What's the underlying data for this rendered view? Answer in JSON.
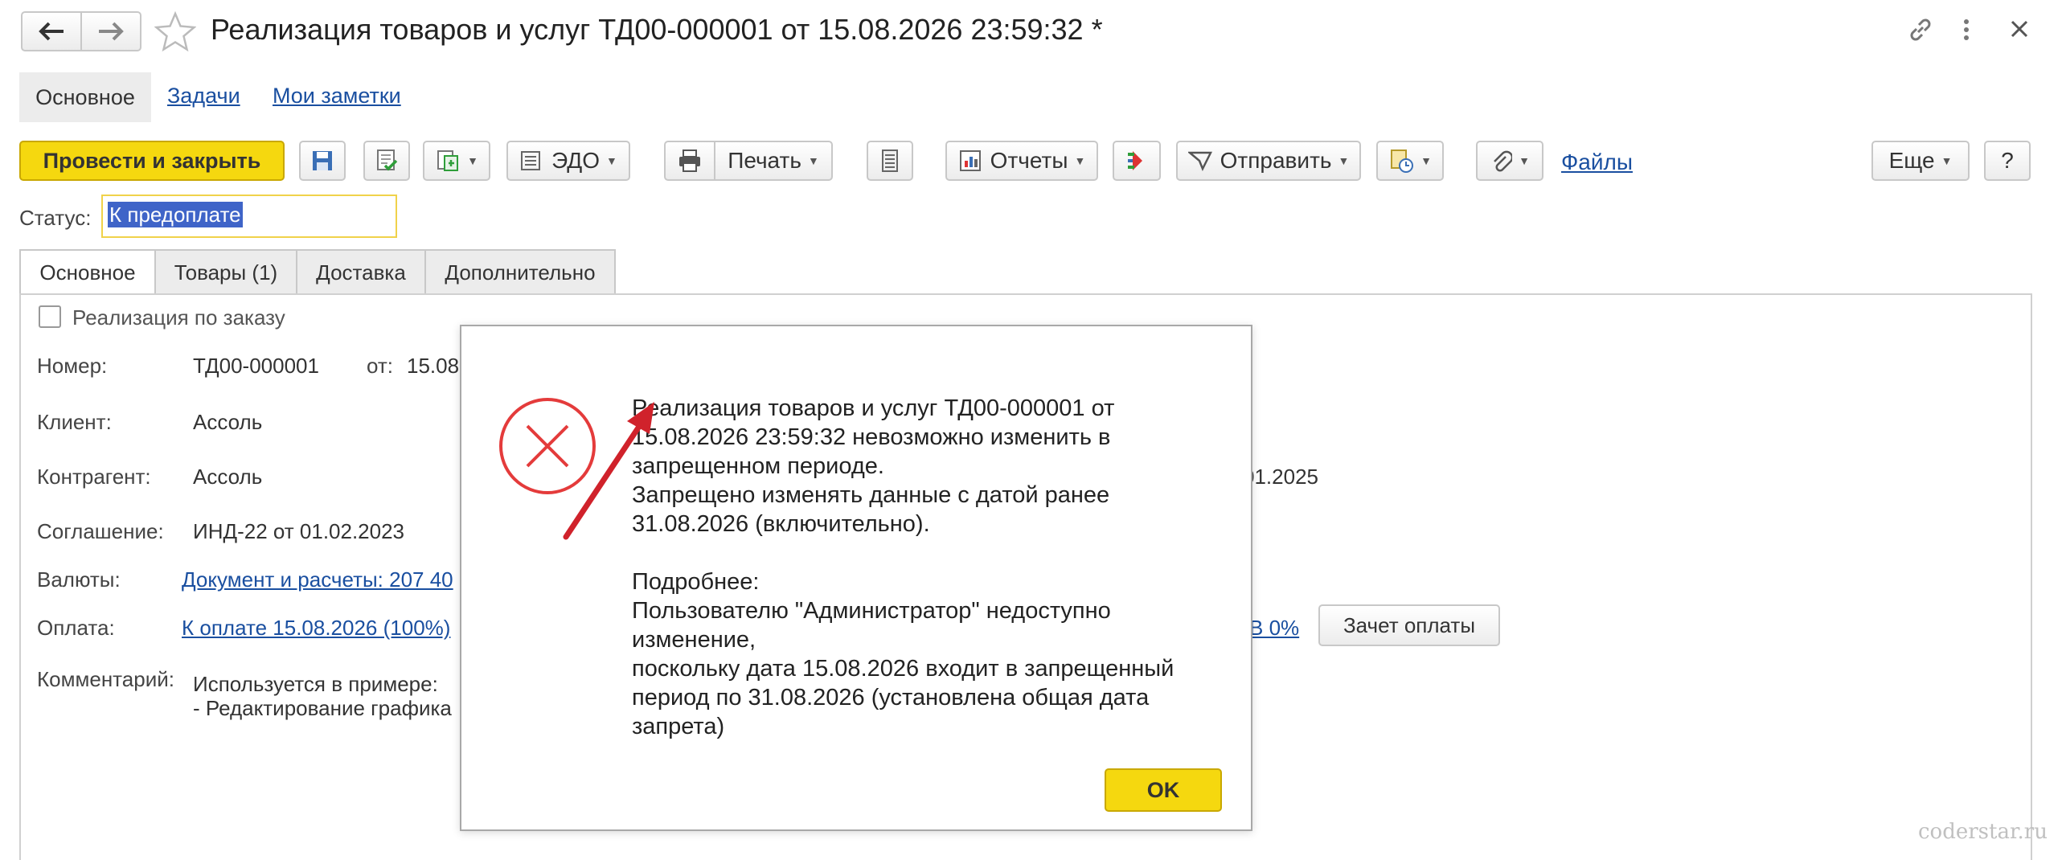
{
  "window": {
    "title": "Реализация товаров и услуг ТД00-000001 от 15.08.2026 23:59:32 *"
  },
  "nav_tabs": [
    {
      "label": "Основное"
    },
    {
      "label": "Задачи"
    },
    {
      "label": "Мои заметки"
    }
  ],
  "toolbar": {
    "post_close": "Провести и закрыть",
    "edo": "ЭДО",
    "print": "Печать",
    "reports": "Отчеты",
    "send": "Отправить",
    "files": "Файлы",
    "more": "Еще",
    "help": "?"
  },
  "status": {
    "label": "Статус:",
    "value": "К предоплате"
  },
  "form_tabs": [
    {
      "label": "Основное"
    },
    {
      "label": "Товары (1)"
    },
    {
      "label": "Доставка"
    },
    {
      "label": "Дополнительно"
    }
  ],
  "form": {
    "by_order": "Реализация по заказу",
    "number_label": "Номер:",
    "number_value": "ТД00-000001",
    "from_label": "от:",
    "from_value": "15.08",
    "client_label": "Клиент:",
    "client_value": "Ассоль",
    "contractor_label": "Контрагент:",
    "contractor_value": "Ассоль",
    "contractor_date": "01.2025",
    "agreement_label": "Соглашение:",
    "agreement_value": "ИНД-22 от 01.02.2023",
    "currency_label": "Валюты:",
    "currency_value": "Документ и расчеты: 207 40",
    "payment_label": "Оплата:",
    "payment_value": "К оплате 15.08.2026 (100%)",
    "payment_vat": "В 0%",
    "offset_button": "Зачет оплаты",
    "comment_label": "Комментарий:",
    "comment_line1": "Используется в примере:",
    "comment_line2": "- Редактирование графика"
  },
  "dialog": {
    "message_lines": [
      "Реализация товаров и услуг ТД00-000001 от",
      "15.08.2026 23:59:32 невозможно изменить в",
      "запрещенном периоде.",
      "Запрещено изменять данные с датой ранее",
      "31.08.2026 (включительно)."
    ],
    "details_lines": [
      "Подробнее:",
      "Пользователю \"Администратор\" недоступно",
      "изменение,",
      "поскольку дата 15.08.2026 входит в запрещенный",
      "период по 31.08.2026 (установлена общая дата",
      "запрета)"
    ],
    "ok": "OK"
  },
  "watermark": "coderstar.ru",
  "colors": {
    "primary_button": "#f5d80f",
    "error": "#e43b3b",
    "link": "#1a4fa0",
    "selection": "#3f64c8",
    "arrow": "#d0222b"
  }
}
